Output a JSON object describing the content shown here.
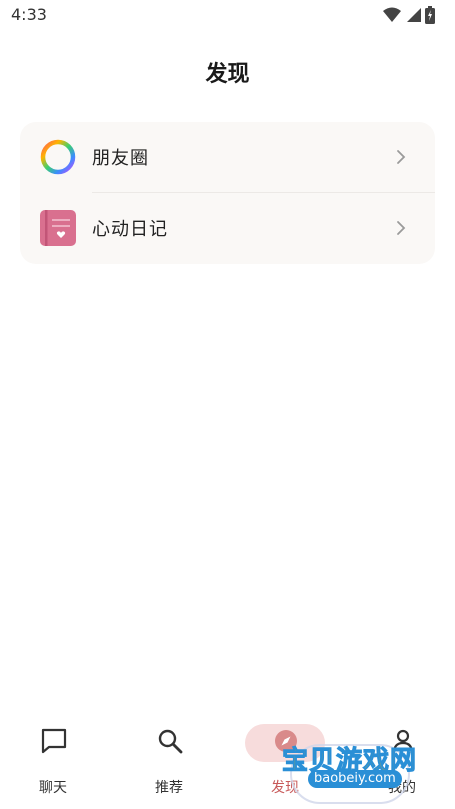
{
  "status_bar": {
    "time": "4:33"
  },
  "header": {
    "title": "发现"
  },
  "discover_items": [
    {
      "label": "朋友圈",
      "icon": "color-ring-icon"
    },
    {
      "label": "心动日记",
      "icon": "diary-book-icon"
    }
  ],
  "tabbar": {
    "tabs": [
      {
        "label": "聊天",
        "icon": "chat-bubble-icon"
      },
      {
        "label": "推荐",
        "icon": "search-icon"
      },
      {
        "label": "发现",
        "icon": "compass-icon",
        "active": true
      },
      {
        "label": "我的",
        "icon": "user-icon"
      }
    ]
  },
  "watermark": {
    "text": "宝贝游戏网",
    "url": "baobeiy.com"
  },
  "colors": {
    "card_bg": "#faf8f6",
    "active_pill": "#f7dcdc",
    "active_text": "#c85a5a",
    "diary_pink": "#d9708f"
  }
}
